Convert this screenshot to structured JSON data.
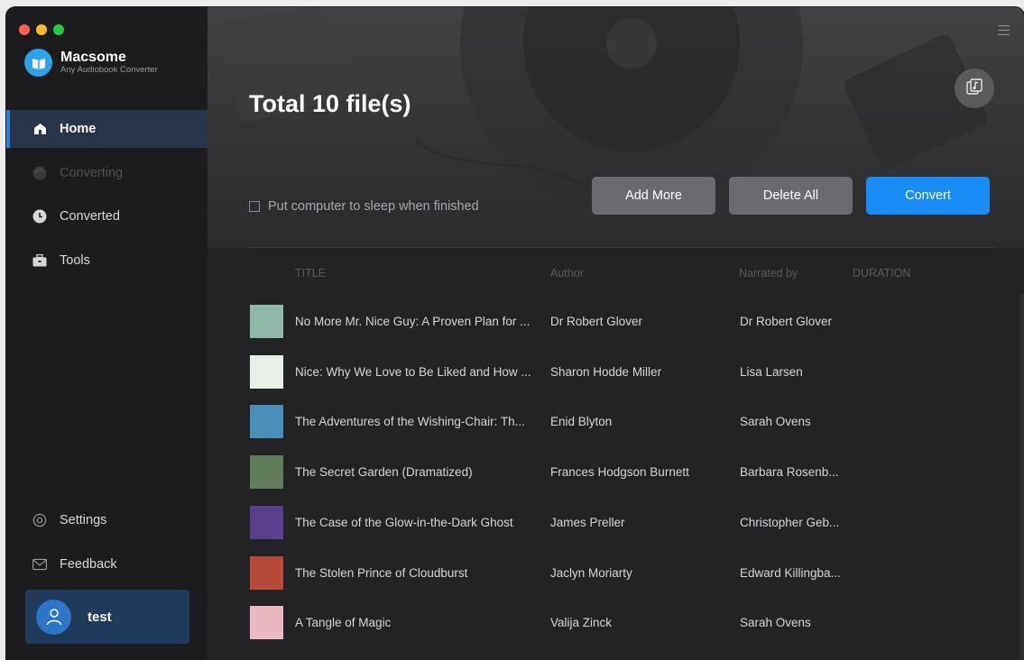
{
  "app": {
    "name": "Macsome",
    "subtitle": "Any Audiobook Converter"
  },
  "sidebar": {
    "items": [
      {
        "label": "Home",
        "icon": "home-icon",
        "state": "active"
      },
      {
        "label": "Converting",
        "icon": "converting-icon",
        "state": "disabled"
      },
      {
        "label": "Converted",
        "icon": "clock-icon",
        "state": "normal"
      },
      {
        "label": "Tools",
        "icon": "toolbox-icon",
        "state": "normal"
      }
    ],
    "bottom": [
      {
        "label": "Settings",
        "icon": "settings-icon"
      },
      {
        "label": "Feedback",
        "icon": "mail-icon"
      }
    ],
    "user": {
      "name": "test"
    }
  },
  "main": {
    "title": "Total 10 file(s)",
    "sleep_label": "Put computer to sleep when finished",
    "buttons": {
      "add_more": "Add More",
      "delete_all": "Delete All",
      "convert": "Convert"
    },
    "columns": {
      "title": "TITLE",
      "author": "Author",
      "narrated": "Narrated by",
      "duration": "DURATION"
    },
    "rows": [
      {
        "title": "No More Mr. Nice Guy: A Proven Plan for ...",
        "author": "Dr Robert Glover",
        "narrated": "Dr Robert Glover",
        "cover": "#8fb8a8"
      },
      {
        "title": "Nice: Why We Love to Be Liked and How ...",
        "author": "Sharon Hodde Miller",
        "narrated": "Lisa Larsen",
        "cover": "#e8efe6"
      },
      {
        "title": "The Adventures of the Wishing-Chair: Th...",
        "author": "Enid Blyton",
        "narrated": "Sarah Ovens",
        "cover": "#4a8fb8"
      },
      {
        "title": "The Secret Garden (Dramatized)",
        "author": "Frances Hodgson Burnett",
        "narrated": "Barbara Rosenb...",
        "cover": "#5f7d5a"
      },
      {
        "title": "The Case of the Glow-in-the-Dark Ghost",
        "author": "James Preller",
        "narrated": "Christopher Geb...",
        "cover": "#5a3f8a"
      },
      {
        "title": "The Stolen Prince of Cloudburst",
        "author": "Jaclyn Moriarty",
        "narrated": "Edward Killingba...",
        "cover": "#b84a3a"
      },
      {
        "title": "A Tangle of Magic",
        "author": "Valija Zinck",
        "narrated": "Sarah Ovens",
        "cover": "#e9b8c0"
      }
    ]
  },
  "colors": {
    "accent": "#1a8cf5",
    "sidebar_active": "#27344a",
    "user_box": "#1f3a5a"
  }
}
